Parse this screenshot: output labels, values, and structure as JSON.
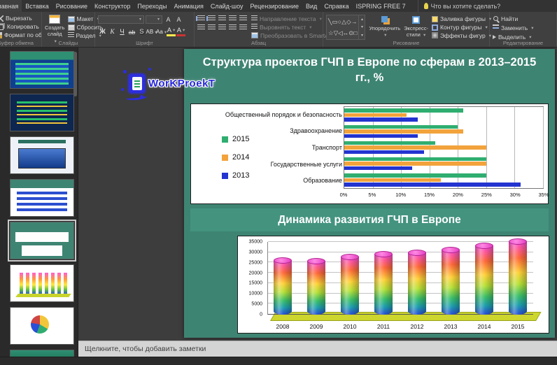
{
  "ribbon": {
    "tabs": [
      {
        "label": "Главная",
        "active": true
      },
      {
        "label": "Вставка"
      },
      {
        "label": "Рисование"
      },
      {
        "label": "Конструктор"
      },
      {
        "label": "Переходы"
      },
      {
        "label": "Анимация"
      },
      {
        "label": "Слайд-шоу"
      },
      {
        "label": "Рецензирование"
      },
      {
        "label": "Вид"
      },
      {
        "label": "Справка"
      },
      {
        "label": "ISPRING FREE 7"
      }
    ],
    "search_label": "Что вы хотите сделать?",
    "clipboard": {
      "cut": "Вырезать",
      "copy": "Копировать",
      "format_painter": "Формат по образцу",
      "group_label": "Буфер обмена"
    },
    "slides": {
      "new_slide": "Создать слайд",
      "layout": "Макет",
      "reset": "Сбросить",
      "section": "Раздел",
      "group_label": "Слайды"
    },
    "font": {
      "bold": "Ж",
      "italic": "К",
      "underline": "Ч",
      "strikethrough": "ab",
      "shadow": "S",
      "spacing": "АВ",
      "case": "Аа",
      "color": "А",
      "grow": "А",
      "shrink": "А",
      "group_label": "Шрифт"
    },
    "paragraph": {
      "text_direction": "Направление текста",
      "align_text": "Выровнять текст",
      "smartart": "Преобразовать в SmartArt",
      "group_label": "Абзац"
    },
    "drawing": {
      "arrange": "Упорядочить",
      "quick_styles": "Экспресс-стили",
      "shape_fill": "Заливка фигуры",
      "shape_outline": "Контур фигуры",
      "shape_effects": "Эффекты фигур",
      "shape_glyphs": [
        [
          "╲",
          "▭",
          "○",
          "△",
          "◇",
          "→"
        ],
        [
          "☆",
          "▽",
          "◁",
          "↔",
          "⊙",
          "□"
        ]
      ],
      "group_label": "Рисование"
    },
    "editing": {
      "find": "Найти",
      "replace": "Заменить",
      "select": "Выделить",
      "group_label": "Редактирование"
    }
  },
  "slide": {
    "title1": "Структура проектов ГЧП в Европе по сферам в 2013–2015 гг., %",
    "title2": "Динамика развития ГЧП в Европе"
  },
  "watermark": {
    "text": "WorKProekT"
  },
  "notes_placeholder": "Щелкните, чтобы добавить заметки",
  "colors": {
    "series_2015": "#2fae70",
    "series_2014": "#f2a33c",
    "series_2013": "#2334d0",
    "slide_bg": "#3e8473",
    "band_bg": "#43937f",
    "watermark_blue": "#2d2de0"
  },
  "chart_data": [
    {
      "type": "bar",
      "orientation": "horizontal",
      "title": "Структура проектов ГЧП в Европе по сферам в 2013–2015 гг., %",
      "categories": [
        "Общественный порядок и безопасность",
        "Здравоохранение",
        "Транспорт",
        "Государственные услуги",
        "Образование"
      ],
      "series": [
        {
          "name": "2015",
          "color": "#2fae70",
          "values": [
            21,
            20,
            16,
            25,
            25
          ]
        },
        {
          "name": "2014",
          "color": "#f2a33c",
          "values": [
            11,
            21,
            25,
            25,
            17
          ]
        },
        {
          "name": "2013",
          "color": "#2334d0",
          "values": [
            13,
            13,
            14,
            12,
            31
          ]
        }
      ],
      "x_ticks": [
        "0%",
        "5%",
        "10%",
        "15%",
        "20%",
        "25%",
        "30%",
        "35%"
      ],
      "xlim": [
        0,
        35
      ],
      "legend_position": "left",
      "grid": true
    },
    {
      "type": "bar",
      "subtype": "cylinder-3d",
      "title": "Динамика развития ГЧП в Европе",
      "categories": [
        "2008",
        "2009",
        "2010",
        "2011",
        "2012",
        "2013",
        "2014",
        "2015"
      ],
      "values": [
        26000,
        25500,
        27500,
        29000,
        29500,
        31000,
        33000,
        35000
      ],
      "y_ticks": [
        0,
        5000,
        10000,
        15000,
        20000,
        25000,
        30000,
        35000
      ],
      "ylim": [
        0,
        35000
      ],
      "grid": true
    }
  ]
}
